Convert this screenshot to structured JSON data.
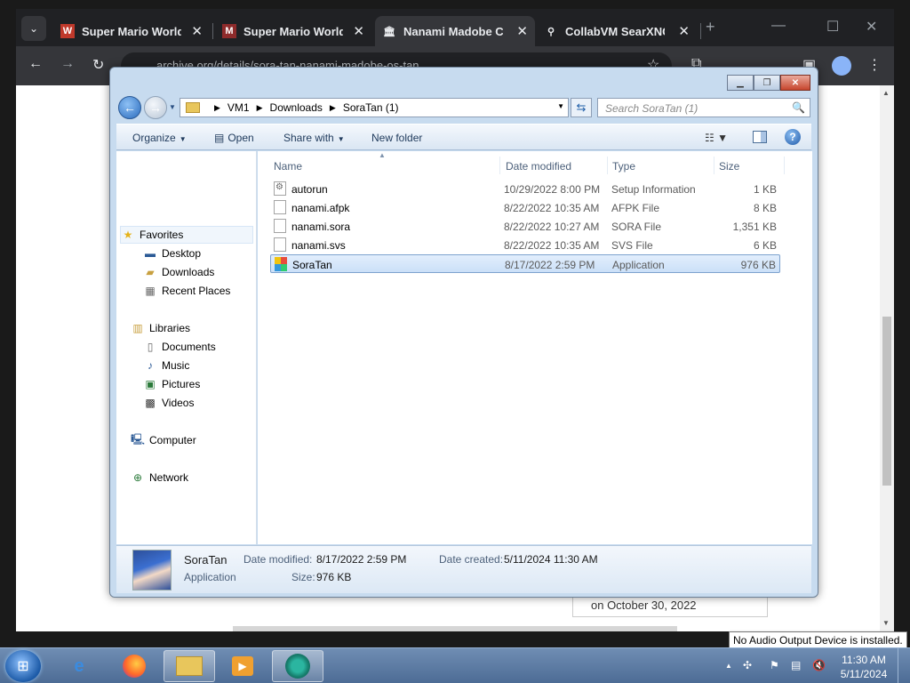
{
  "browser": {
    "tabs": [
      {
        "title": "Super Mario World |",
        "icon": "wario-icon"
      },
      {
        "title": "Super Mario World",
        "icon": "mario-icon"
      },
      {
        "title": "Nanami Madobe CD",
        "icon": "archive-icon"
      },
      {
        "title": "CollabVM SearXNG",
        "icon": "searxng-icon"
      }
    ],
    "url": "archive.org/details/sora-tan-nanami-madobe-os-tan",
    "page_date_text": "on October 30, 2022"
  },
  "explorer": {
    "breadcrumb": [
      "VM1",
      "Downloads",
      "SoraTan (1)"
    ],
    "search_placeholder": "Search SoraTan (1)",
    "commands": {
      "organize": "Organize",
      "open": "Open",
      "share": "Share with",
      "new_folder": "New folder"
    },
    "nav": {
      "favorites": "Favorites",
      "desktop": "Desktop",
      "downloads": "Downloads",
      "recent": "Recent Places",
      "libraries": "Libraries",
      "documents": "Documents",
      "music": "Music",
      "pictures": "Pictures",
      "videos": "Videos",
      "computer": "Computer",
      "network": "Network"
    },
    "columns": {
      "name": "Name",
      "date": "Date modified",
      "type": "Type",
      "size": "Size"
    },
    "files": [
      {
        "name": "autorun",
        "date": "10/29/2022 8:00 PM",
        "type": "Setup Information",
        "size": "1 KB"
      },
      {
        "name": "nanami.afpk",
        "date": "8/22/2022 10:35 AM",
        "type": "AFPK File",
        "size": "8 KB"
      },
      {
        "name": "nanami.sora",
        "date": "8/22/2022 10:27 AM",
        "type": "SORA File",
        "size": "1,351 KB"
      },
      {
        "name": "nanami.svs",
        "date": "8/22/2022 10:35 AM",
        "type": "SVS File",
        "size": "6 KB"
      },
      {
        "name": "SoraTan",
        "date": "8/17/2022 2:59 PM",
        "type": "Application",
        "size": "976 KB"
      }
    ],
    "details": {
      "name": "SoraTan",
      "kind": "Application",
      "modified_label": "Date modified:",
      "modified_value": "8/17/2022 2:59 PM",
      "created_label": "Date created:",
      "created_value": "5/11/2024 11:30 AM",
      "size_label": "Size:",
      "size_value": "976 KB"
    }
  },
  "taskbar": {
    "time": "11:30 AM",
    "date": "5/11/2024",
    "tooltip": "No Audio Output Device is installed."
  }
}
